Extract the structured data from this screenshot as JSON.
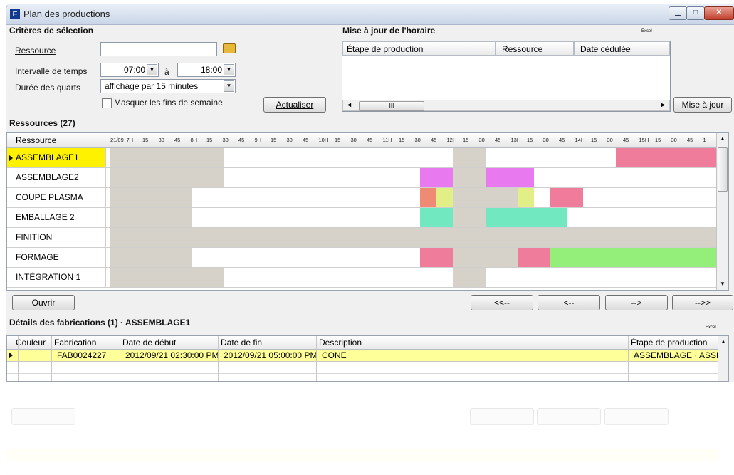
{
  "window": {
    "title": "Plan des productions"
  },
  "criteria": {
    "heading": "Critères de sélection",
    "resource_label": "Ressource",
    "resource_value": "",
    "interval_label": "Intervalle de temps",
    "start_time": "07:00",
    "between": "à",
    "end_time": "18:00",
    "shift_label": "Durée des quarts",
    "shift_value": "affichage par 15 minutes",
    "hide_weekends": "Masquer les fins de semaine",
    "refresh": "Actualiser"
  },
  "schedule_update": {
    "heading": "Mise à jour de l'horaire",
    "columns": [
      "Étape de production",
      "Ressource",
      "Date cédulée"
    ],
    "small_tag": "Excel",
    "scroll_mark": "III",
    "update_button": "Mise à jour"
  },
  "resources": {
    "heading": "Ressources (27)",
    "column": "Ressource",
    "ticks": [
      "21/09",
      "7H",
      "15",
      "30",
      "45",
      "8H",
      "15",
      "30",
      "45",
      "9H",
      "15",
      "30",
      "45",
      "10H",
      "15",
      "30",
      "45",
      "11H",
      "15",
      "30",
      "45",
      "12H",
      "15",
      "30",
      "45",
      "13H",
      "15",
      "30",
      "45",
      "14H",
      "15",
      "30",
      "45",
      "15H",
      "15",
      "30",
      "45",
      "1"
    ],
    "rows": [
      {
        "name": "ASSEMBLAGE1",
        "selected": true
      },
      {
        "name": "ASSEMBLAGE2",
        "selected": false
      },
      {
        "name": "COUPE PLASMA",
        "selected": false
      },
      {
        "name": "EMBALLAGE 2",
        "selected": false
      },
      {
        "name": "FINITION",
        "selected": false
      },
      {
        "name": "FORMAGE",
        "selected": false
      },
      {
        "name": "INTÉGRATION 1",
        "selected": false
      }
    ],
    "colors": {
      "offhours": "#d6d1c9",
      "pink": "#f07c9c",
      "magenta": "#e879ef",
      "salmon": "#ef8a75",
      "yellow": "#e1ef86",
      "mint": "#72e8c1",
      "green": "#94ee7a",
      "selected": "#fff200"
    }
  },
  "navigation": {
    "open": "Ouvrir",
    "first": "<<--",
    "prev": "<--",
    "next": "-->",
    "last": "-->>"
  },
  "details": {
    "heading": "Détails des fabrications (1) · ASSEMBLAGE1",
    "small_tag": "Excel",
    "columns": [
      "Couleur",
      "Fabrication",
      "Date de début",
      "Date de fin",
      "Description",
      "Étape de production"
    ],
    "row": {
      "fabrication": "FAB0024227",
      "start": "2012/09/21 02:30:00 PM",
      "end": "2012/09/21 05:00:00 PM",
      "description": "CONE",
      "step": "ASSEMBLAGE · ASSEMBL"
    }
  }
}
